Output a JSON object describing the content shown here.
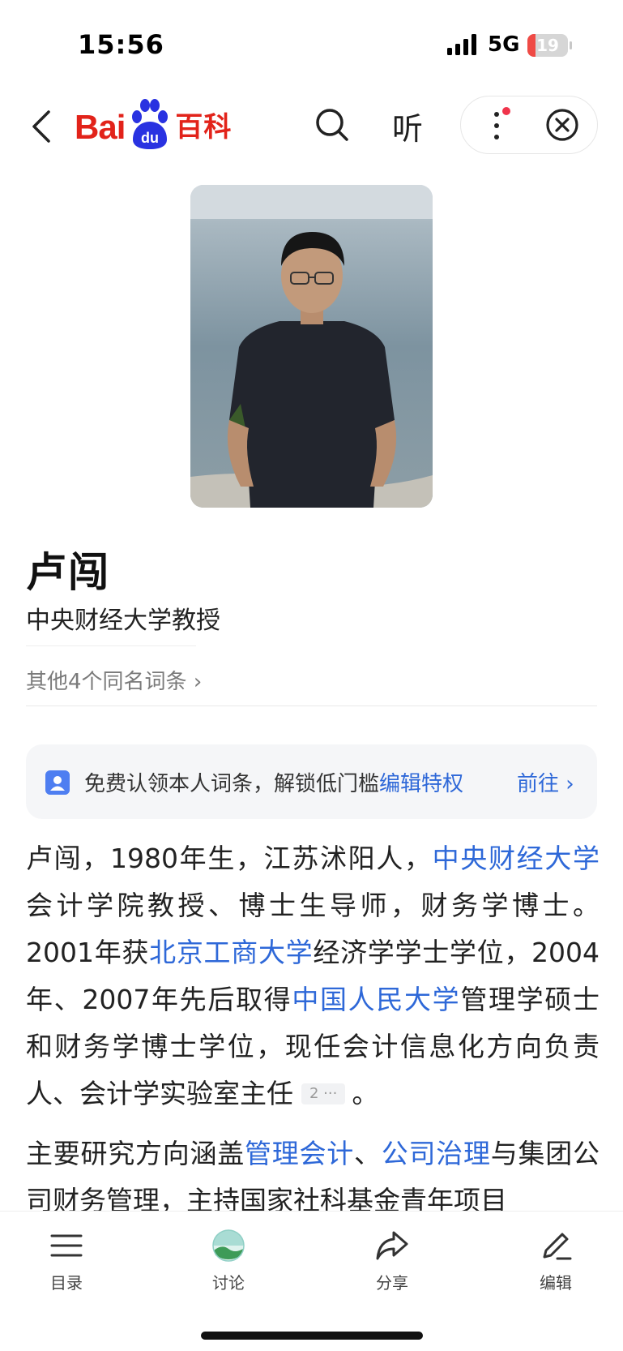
{
  "status": {
    "time": "15:56",
    "network": "5G",
    "battery": "19",
    "battery_level": 0.19
  },
  "nav": {
    "logo_bai": "Bai",
    "logo_du": "du",
    "logo_baike": "百科",
    "listen_label": "听"
  },
  "entry": {
    "title": "卢闯",
    "subtitle": "中央财经大学教授",
    "homonym": "其他4个同名词条",
    "homonym_arrow": "›"
  },
  "claim": {
    "text": "免费认领本人词条，解锁低门槛",
    "link": "编辑特权",
    "action": "前往",
    "arrow": "›"
  },
  "article": {
    "p1": {
      "t1": "卢闯，1980年生，江苏沭阳人，",
      "l1": "中央财经大学",
      "t2": "会计学院教授、博士生导师，财务学博士。2001年获",
      "l2": "北京工商大学",
      "t3": "经济学学士学位，2004年、2007年先后取得",
      "l3": "中国人民大学",
      "t4": "管理学硕士和财务学博士学位，现任会计信息化方向负责人、会计学实验室主任",
      "ref": "2 ···",
      "t5": "。"
    },
    "p2": {
      "t1": "主要研究方向涵盖",
      "l1": "管理会计",
      "t2": "、",
      "l2": "公司治理",
      "t3": "与集团公司财务管理，主持国家社科基金青年项目"
    }
  },
  "toolbar": {
    "items": [
      {
        "label": "目录",
        "icon": "list-icon"
      },
      {
        "label": "讨论",
        "icon": "discussion-icon"
      },
      {
        "label": "分享",
        "icon": "share-icon"
      },
      {
        "label": "编辑",
        "icon": "edit-icon"
      }
    ]
  },
  "colors": {
    "brand_red": "#e2231a",
    "link_blue": "#2e68d8",
    "brand_blue": "#2932e1"
  }
}
